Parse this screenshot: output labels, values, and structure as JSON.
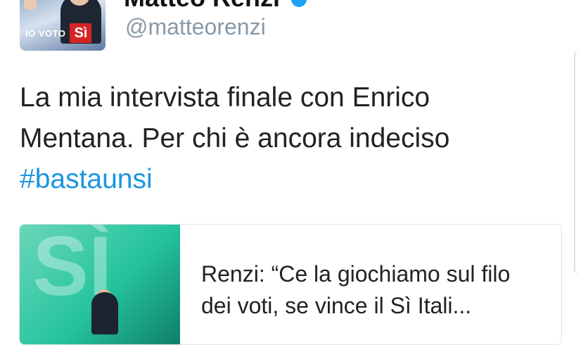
{
  "profile": {
    "name_partial": "Matteo Renzi",
    "handle": "@matteorenzi",
    "avatar_badge": {
      "io_voto": "IO VOTO",
      "si": "Sì"
    }
  },
  "tweet": {
    "text_line1": "La mia intervista finale con Enrico",
    "text_line2": "Mentana. Per chi è ancora indeciso",
    "hashtag": "#bastaunsi"
  },
  "card": {
    "title": "Renzi: “Ce la giochiamo sul filo dei voti, se vince il Sì Itali..."
  },
  "colors": {
    "hashtag": "#1b95e0",
    "handle": "#8899a6",
    "badge_red": "#d62424"
  }
}
